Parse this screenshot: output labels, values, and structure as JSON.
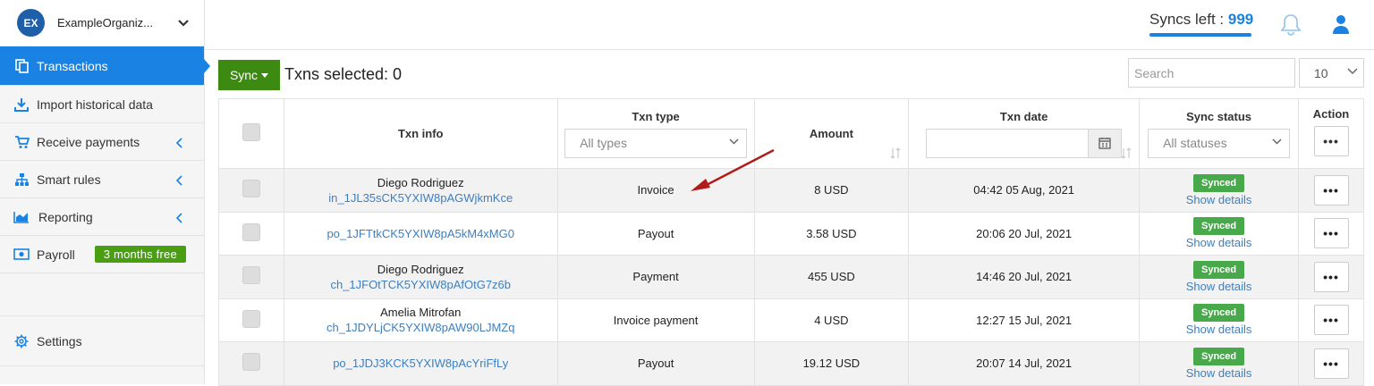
{
  "org": {
    "initials": "EX",
    "name": "ExampleOrganiz..."
  },
  "sidebar": {
    "items": [
      {
        "label": "Transactions",
        "icon": "copy-icon"
      },
      {
        "label": "Import historical data",
        "icon": "download-icon"
      },
      {
        "label": "Receive payments",
        "icon": "cart-icon"
      },
      {
        "label": "Smart rules",
        "icon": "sitemap-icon"
      },
      {
        "label": "Reporting",
        "icon": "chart-icon"
      },
      {
        "label": "Payroll",
        "icon": "money-icon",
        "badge": "3 months free"
      },
      {
        "label": "Settings",
        "icon": "gear-icon"
      }
    ]
  },
  "header": {
    "syncs_label": "Syncs left :",
    "syncs_value": "999"
  },
  "toolbar": {
    "sync_label": "Sync",
    "txns_selected": "Txns selected: 0"
  },
  "search": {
    "placeholder": "Search"
  },
  "per_page": "10",
  "table": {
    "headers": {
      "info": "Txn info",
      "type": "Txn type",
      "amount": "Amount",
      "date": "Txn date",
      "status": "Sync status",
      "action": "Action"
    },
    "type_filter": "All types",
    "status_filter": "All statuses",
    "rows": [
      {
        "name": "Diego Rodriguez",
        "id": "in_1JL35sCK5YXIW8pAGWjkmKce",
        "type": "Invoice",
        "amount": "8 USD",
        "date": "04:42 05 Aug, 2021",
        "status": "Synced",
        "details": "Show details",
        "action": "•••"
      },
      {
        "name": "",
        "id": "po_1JFTtkCK5YXIW8pA5kM4xMG0",
        "type": "Payout",
        "amount": "3.58 USD",
        "date": "20:06 20 Jul, 2021",
        "status": "Synced",
        "details": "Show details",
        "action": "•••"
      },
      {
        "name": "Diego Rodriguez",
        "id": "ch_1JFOtTCK5YXIW8pAfOtG7z6b",
        "type": "Payment",
        "amount": "455 USD",
        "date": "14:46 20 Jul, 2021",
        "status": "Synced",
        "details": "Show details",
        "action": "•••"
      },
      {
        "name": "Amelia Mitrofan",
        "id": "ch_1JDYLjCK5YXIW8pAW90LJMZq",
        "type": "Invoice payment",
        "amount": "4 USD",
        "date": "12:27 15 Jul, 2021",
        "status": "Synced",
        "details": "Show details",
        "action": "•••"
      },
      {
        "name": "",
        "id": "po_1JDJ3KCK5YXIW8pAcYriFfLy",
        "type": "Payout",
        "amount": "19.12 USD",
        "date": "20:07 14 Jul, 2021",
        "status": "Synced",
        "details": "Show details",
        "action": "•••"
      }
    ]
  },
  "colors": {
    "accent": "#1a82e2",
    "sync_button": "#3c8a12",
    "synced_badge": "#48a94b",
    "annotation_arrow": "#b01c1c"
  }
}
